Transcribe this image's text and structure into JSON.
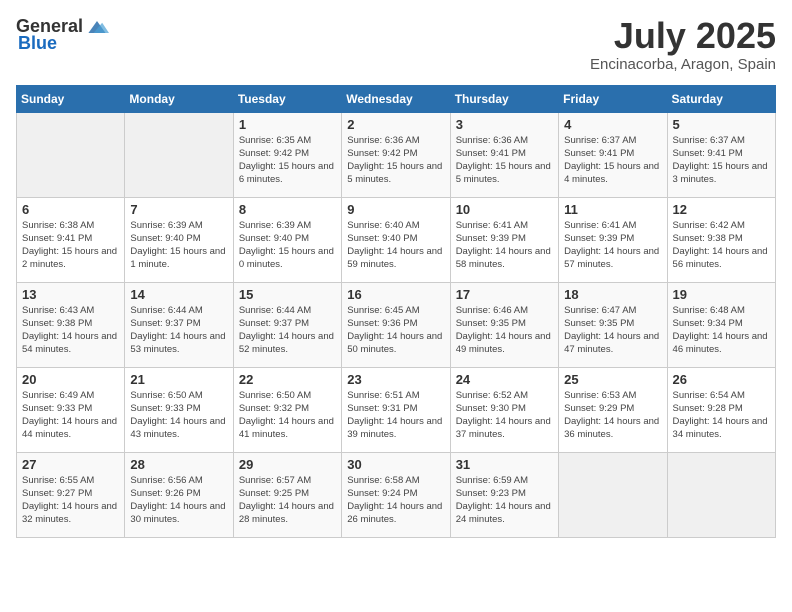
{
  "header": {
    "logo_general": "General",
    "logo_blue": "Blue",
    "month": "July 2025",
    "location": "Encinacorba, Aragon, Spain"
  },
  "days_of_week": [
    "Sunday",
    "Monday",
    "Tuesday",
    "Wednesday",
    "Thursday",
    "Friday",
    "Saturday"
  ],
  "weeks": [
    [
      {
        "day": "",
        "info": ""
      },
      {
        "day": "",
        "info": ""
      },
      {
        "day": "1",
        "sunrise": "Sunrise: 6:35 AM",
        "sunset": "Sunset: 9:42 PM",
        "daylight": "Daylight: 15 hours and 6 minutes."
      },
      {
        "day": "2",
        "sunrise": "Sunrise: 6:36 AM",
        "sunset": "Sunset: 9:42 PM",
        "daylight": "Daylight: 15 hours and 5 minutes."
      },
      {
        "day": "3",
        "sunrise": "Sunrise: 6:36 AM",
        "sunset": "Sunset: 9:41 PM",
        "daylight": "Daylight: 15 hours and 5 minutes."
      },
      {
        "day": "4",
        "sunrise": "Sunrise: 6:37 AM",
        "sunset": "Sunset: 9:41 PM",
        "daylight": "Daylight: 15 hours and 4 minutes."
      },
      {
        "day": "5",
        "sunrise": "Sunrise: 6:37 AM",
        "sunset": "Sunset: 9:41 PM",
        "daylight": "Daylight: 15 hours and 3 minutes."
      }
    ],
    [
      {
        "day": "6",
        "sunrise": "Sunrise: 6:38 AM",
        "sunset": "Sunset: 9:41 PM",
        "daylight": "Daylight: 15 hours and 2 minutes."
      },
      {
        "day": "7",
        "sunrise": "Sunrise: 6:39 AM",
        "sunset": "Sunset: 9:40 PM",
        "daylight": "Daylight: 15 hours and 1 minute."
      },
      {
        "day": "8",
        "sunrise": "Sunrise: 6:39 AM",
        "sunset": "Sunset: 9:40 PM",
        "daylight": "Daylight: 15 hours and 0 minutes."
      },
      {
        "day": "9",
        "sunrise": "Sunrise: 6:40 AM",
        "sunset": "Sunset: 9:40 PM",
        "daylight": "Daylight: 14 hours and 59 minutes."
      },
      {
        "day": "10",
        "sunrise": "Sunrise: 6:41 AM",
        "sunset": "Sunset: 9:39 PM",
        "daylight": "Daylight: 14 hours and 58 minutes."
      },
      {
        "day": "11",
        "sunrise": "Sunrise: 6:41 AM",
        "sunset": "Sunset: 9:39 PM",
        "daylight": "Daylight: 14 hours and 57 minutes."
      },
      {
        "day": "12",
        "sunrise": "Sunrise: 6:42 AM",
        "sunset": "Sunset: 9:38 PM",
        "daylight": "Daylight: 14 hours and 56 minutes."
      }
    ],
    [
      {
        "day": "13",
        "sunrise": "Sunrise: 6:43 AM",
        "sunset": "Sunset: 9:38 PM",
        "daylight": "Daylight: 14 hours and 54 minutes."
      },
      {
        "day": "14",
        "sunrise": "Sunrise: 6:44 AM",
        "sunset": "Sunset: 9:37 PM",
        "daylight": "Daylight: 14 hours and 53 minutes."
      },
      {
        "day": "15",
        "sunrise": "Sunrise: 6:44 AM",
        "sunset": "Sunset: 9:37 PM",
        "daylight": "Daylight: 14 hours and 52 minutes."
      },
      {
        "day": "16",
        "sunrise": "Sunrise: 6:45 AM",
        "sunset": "Sunset: 9:36 PM",
        "daylight": "Daylight: 14 hours and 50 minutes."
      },
      {
        "day": "17",
        "sunrise": "Sunrise: 6:46 AM",
        "sunset": "Sunset: 9:35 PM",
        "daylight": "Daylight: 14 hours and 49 minutes."
      },
      {
        "day": "18",
        "sunrise": "Sunrise: 6:47 AM",
        "sunset": "Sunset: 9:35 PM",
        "daylight": "Daylight: 14 hours and 47 minutes."
      },
      {
        "day": "19",
        "sunrise": "Sunrise: 6:48 AM",
        "sunset": "Sunset: 9:34 PM",
        "daylight": "Daylight: 14 hours and 46 minutes."
      }
    ],
    [
      {
        "day": "20",
        "sunrise": "Sunrise: 6:49 AM",
        "sunset": "Sunset: 9:33 PM",
        "daylight": "Daylight: 14 hours and 44 minutes."
      },
      {
        "day": "21",
        "sunrise": "Sunrise: 6:50 AM",
        "sunset": "Sunset: 9:33 PM",
        "daylight": "Daylight: 14 hours and 43 minutes."
      },
      {
        "day": "22",
        "sunrise": "Sunrise: 6:50 AM",
        "sunset": "Sunset: 9:32 PM",
        "daylight": "Daylight: 14 hours and 41 minutes."
      },
      {
        "day": "23",
        "sunrise": "Sunrise: 6:51 AM",
        "sunset": "Sunset: 9:31 PM",
        "daylight": "Daylight: 14 hours and 39 minutes."
      },
      {
        "day": "24",
        "sunrise": "Sunrise: 6:52 AM",
        "sunset": "Sunset: 9:30 PM",
        "daylight": "Daylight: 14 hours and 37 minutes."
      },
      {
        "day": "25",
        "sunrise": "Sunrise: 6:53 AM",
        "sunset": "Sunset: 9:29 PM",
        "daylight": "Daylight: 14 hours and 36 minutes."
      },
      {
        "day": "26",
        "sunrise": "Sunrise: 6:54 AM",
        "sunset": "Sunset: 9:28 PM",
        "daylight": "Daylight: 14 hours and 34 minutes."
      }
    ],
    [
      {
        "day": "27",
        "sunrise": "Sunrise: 6:55 AM",
        "sunset": "Sunset: 9:27 PM",
        "daylight": "Daylight: 14 hours and 32 minutes."
      },
      {
        "day": "28",
        "sunrise": "Sunrise: 6:56 AM",
        "sunset": "Sunset: 9:26 PM",
        "daylight": "Daylight: 14 hours and 30 minutes."
      },
      {
        "day": "29",
        "sunrise": "Sunrise: 6:57 AM",
        "sunset": "Sunset: 9:25 PM",
        "daylight": "Daylight: 14 hours and 28 minutes."
      },
      {
        "day": "30",
        "sunrise": "Sunrise: 6:58 AM",
        "sunset": "Sunset: 9:24 PM",
        "daylight": "Daylight: 14 hours and 26 minutes."
      },
      {
        "day": "31",
        "sunrise": "Sunrise: 6:59 AM",
        "sunset": "Sunset: 9:23 PM",
        "daylight": "Daylight: 14 hours and 24 minutes."
      },
      {
        "day": "",
        "info": ""
      },
      {
        "day": "",
        "info": ""
      }
    ]
  ]
}
